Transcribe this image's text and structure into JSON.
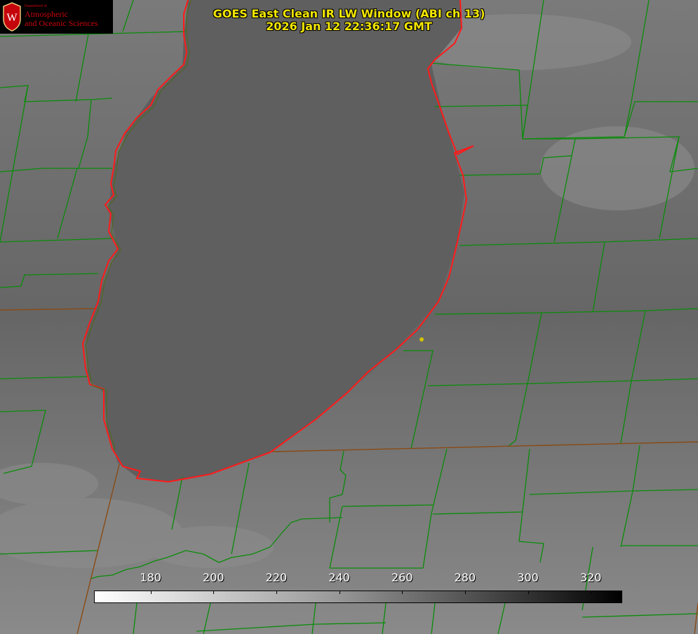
{
  "title": {
    "line1": "GOES East Clean IR LW Window (ABI ch 13)",
    "line2": "2026 Jan 12 22:36:17 GMT"
  },
  "logo": {
    "dept_text": "Department of",
    "line1": "Atmospheric",
    "line2": "and Oceanic Sciences",
    "seal_letter": "W"
  },
  "colorbar": {
    "min": 162,
    "max": 330,
    "ticks": [
      "180",
      "200",
      "220",
      "240",
      "260",
      "280",
      "300",
      "320"
    ]
  },
  "colors": {
    "coastline": "#ff1a1a",
    "boundaries": "#0a8c0a",
    "title": "#f2e600",
    "logo_text": "#c5050c",
    "marker": "#d4c400"
  },
  "icons": [
    "uw-seal-icon",
    "location-marker-icon"
  ]
}
